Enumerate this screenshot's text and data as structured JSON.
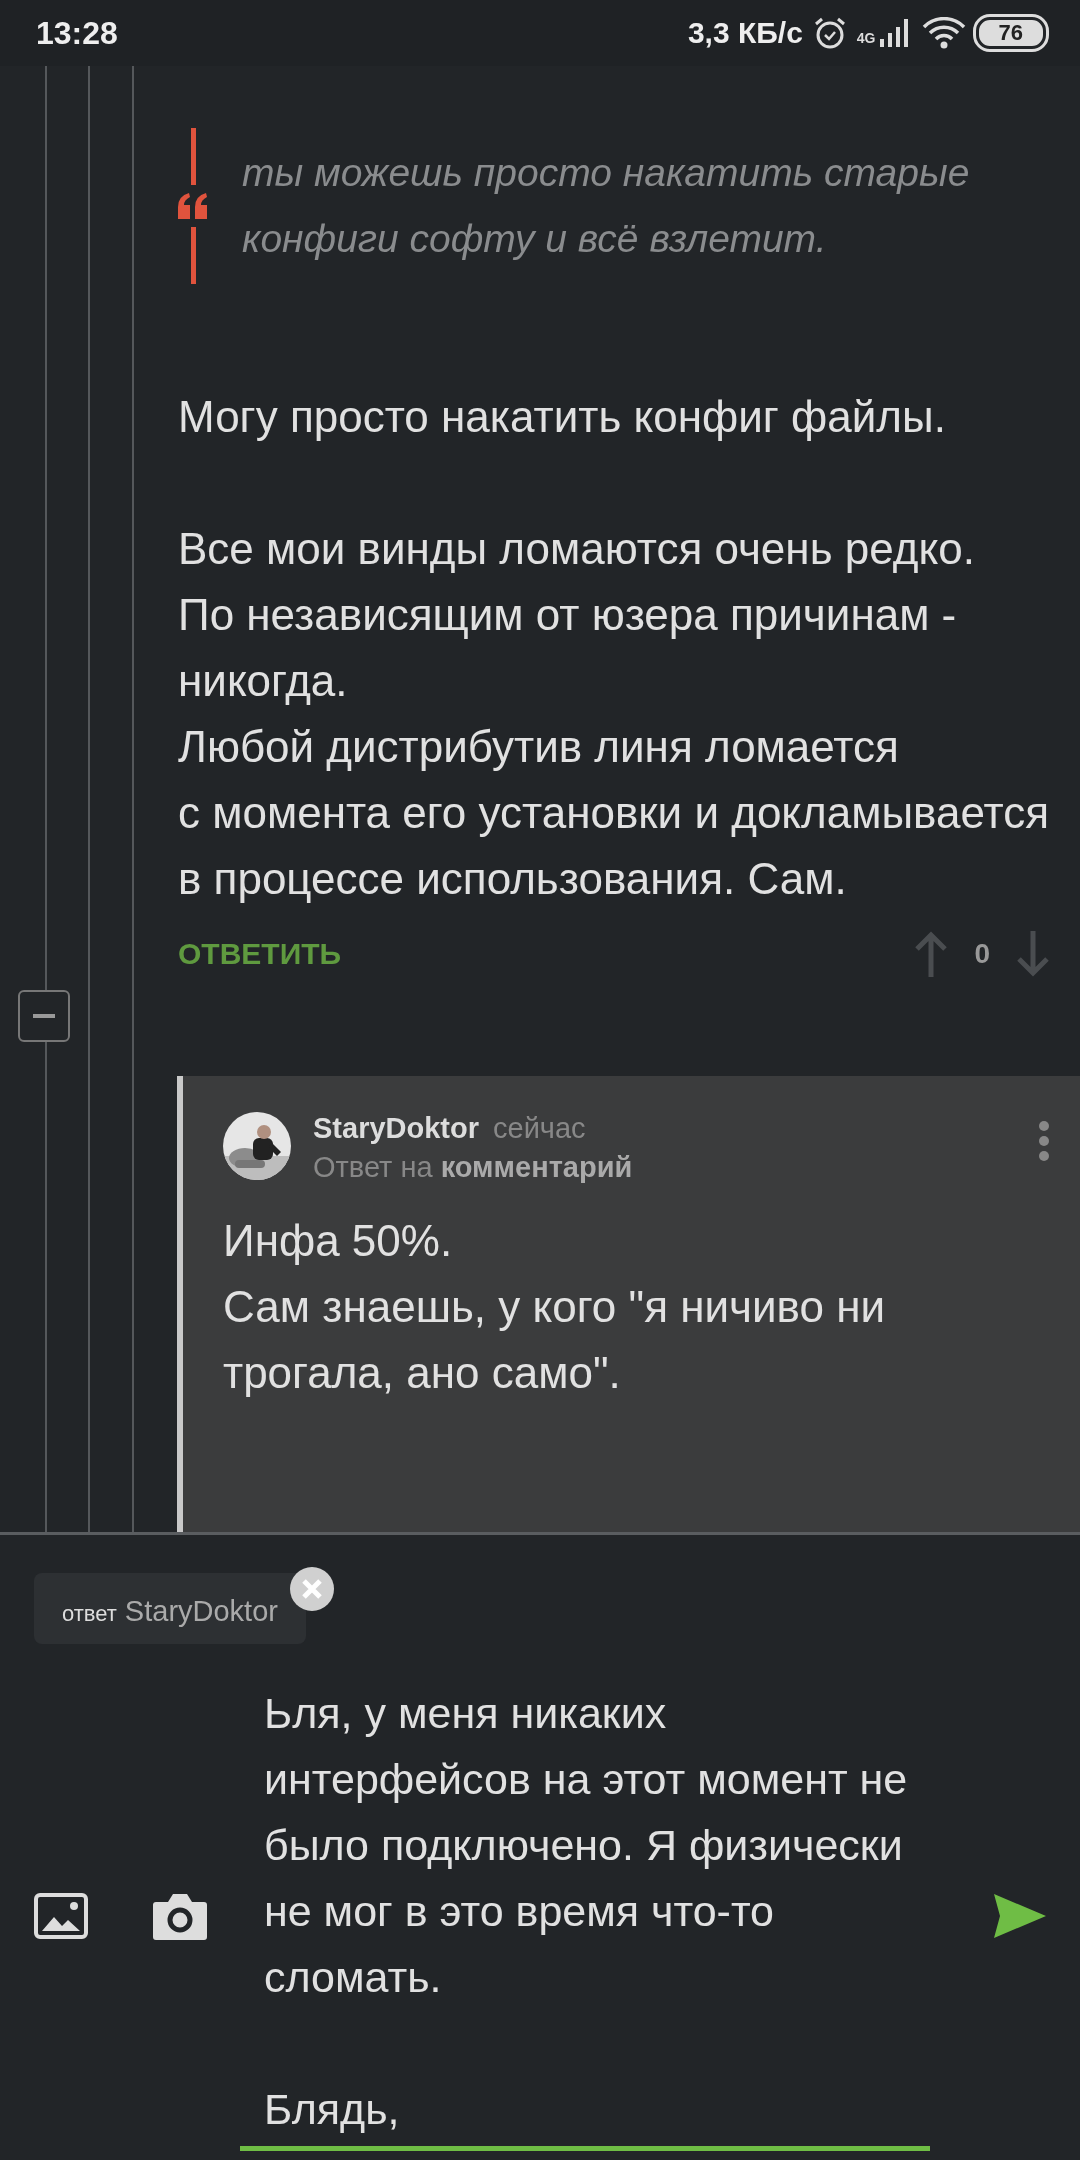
{
  "status_bar": {
    "time": "13:28",
    "network_speed": "3,3 КБ/с",
    "network_type": "4G",
    "battery": "76"
  },
  "comment": {
    "collapse": {
      "expanded": true
    },
    "quote": "ты можешь просто накатить старые конфиги софту и всё взлетит.",
    "paragraphs": [
      "Могу просто накатить конфиг файлы.",
      "Все мои винды ломаются очень редко.\nПо независящим от юзера причинам - никогда.\nЛюбой дистрибутив линя ломается\nс момента его установки и докламывается в процессе использования. Сам."
    ],
    "reply_button": "ОТВЕТИТЬ",
    "score": "0"
  },
  "reply": {
    "author": "StaryDoktor",
    "time": "сейчас",
    "reply_to": "Ответ на **комментарий**",
    "text": "Инфа 50%.\nСам знаешь, у кого \"я ничиво ни трогала, ано само\"."
  },
  "composer": {
    "reply_chip": {
      "prefix": "ответ",
      "name": "StaryDoktor"
    },
    "message": "Ьля, у меня никаких интерфейсов на этот момент не было подключено. Я физически не мог в это время что-то сломать.\n\nБлядь,"
  }
}
